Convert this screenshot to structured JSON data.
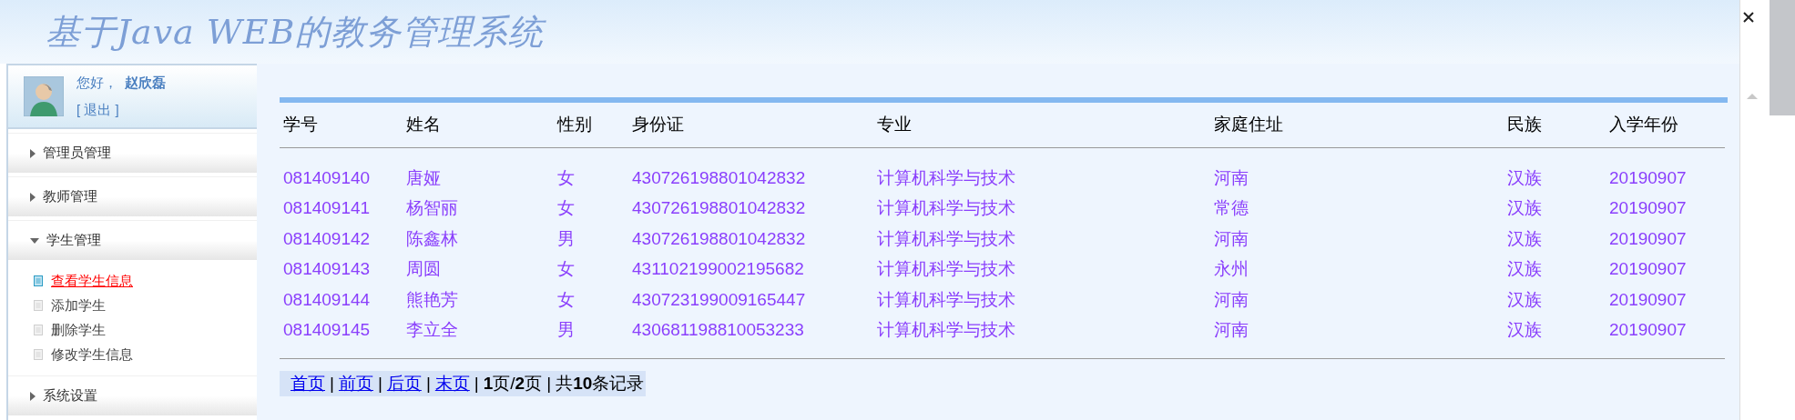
{
  "header": {
    "title": "基于Java WEB的教务管理系统"
  },
  "user": {
    "greeting": "您好，",
    "name": "赵欣磊",
    "logout": "[ 退出 ]"
  },
  "menu": [
    {
      "label": "管理员管理",
      "expanded": false
    },
    {
      "label": "教师管理",
      "expanded": false
    },
    {
      "label": "学生管理",
      "expanded": true,
      "children": [
        {
          "label": "查看学生信息",
          "selected": true
        },
        {
          "label": "添加学生",
          "selected": false
        },
        {
          "label": "删除学生",
          "selected": false
        },
        {
          "label": "修改学生信息",
          "selected": false
        }
      ]
    },
    {
      "label": "系统设置",
      "expanded": false
    }
  ],
  "table": {
    "columns": [
      "学号",
      "姓名",
      "性别",
      "身份证",
      "专业",
      "家庭住址",
      "民族",
      "入学年份"
    ],
    "rows": [
      [
        "081409140",
        "唐娅",
        "女",
        "430726198801042832",
        "计算机科学与技术",
        "河南",
        "汉族",
        "20190907"
      ],
      [
        "081409141",
        "杨智丽",
        "女",
        "430726198801042832",
        "计算机科学与技术",
        "常德",
        "汉族",
        "20190907"
      ],
      [
        "081409142",
        "陈鑫林",
        "男",
        "430726198801042832",
        "计算机科学与技术",
        "河南",
        "汉族",
        "20190907"
      ],
      [
        "081409143",
        "周圆",
        "女",
        "431102199002195682",
        "计算机科学与技术",
        "永州",
        "汉族",
        "20190907"
      ],
      [
        "081409144",
        "熊艳芳",
        "女",
        "430723199009165447",
        "计算机科学与技术",
        "河南",
        "汉族",
        "20190907"
      ],
      [
        "081409145",
        "李立全",
        "男",
        "430681198810053233",
        "计算机科学与技术",
        "河南",
        "汉族",
        "20190907"
      ]
    ]
  },
  "pager": {
    "links": [
      "首页",
      "前页",
      "后页",
      "末页"
    ],
    "separator": "|",
    "page_info": "**1**页/**2**页",
    "total": "共**10**条记录"
  }
}
